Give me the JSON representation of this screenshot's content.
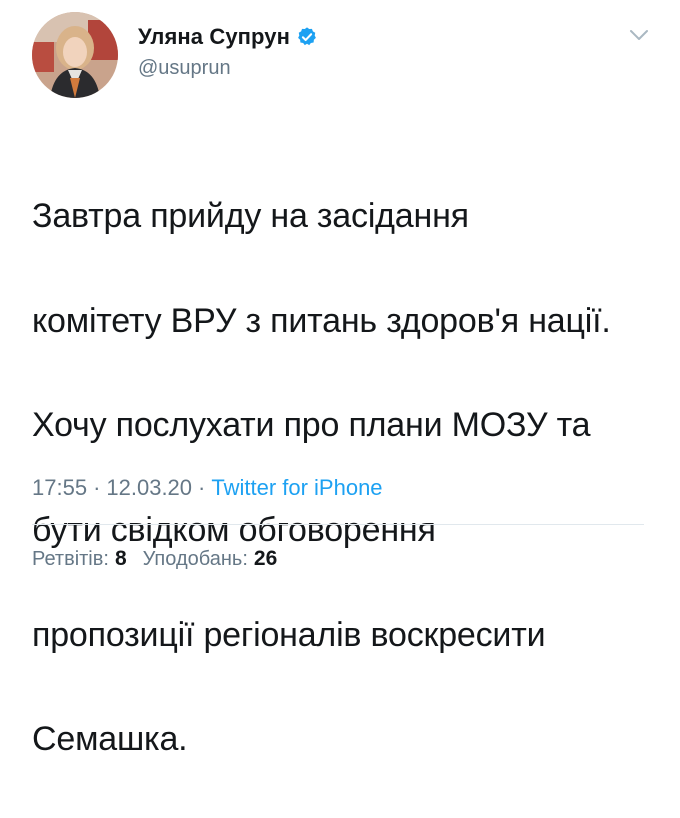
{
  "tweet": {
    "author": {
      "display_name": "Уляна Супрун",
      "handle": "@usuprun",
      "verified": true
    },
    "text_lines": [
      "Завтра прийду на засідання",
      "комітету ВРУ з питань здоров'я нації.",
      "Хочу послухати про плани МОЗУ та",
      "бути свідком обговорення",
      "пропозиції регіоналів воскресити",
      "Семашка."
    ],
    "time": "17:55",
    "date": "12.03.20",
    "separator": "·",
    "source": "Twitter for iPhone",
    "stats": {
      "retweets_label": "Ретвітів:",
      "retweets": "8",
      "likes_label": "Уподобань:",
      "likes": "26"
    }
  },
  "icons": {
    "verified": "verified-badge-icon",
    "caret": "chevron-down-icon"
  },
  "colors": {
    "accent": "#1da1f2",
    "text": "#14171a",
    "muted": "#657786",
    "divider": "#e1e8ed"
  }
}
